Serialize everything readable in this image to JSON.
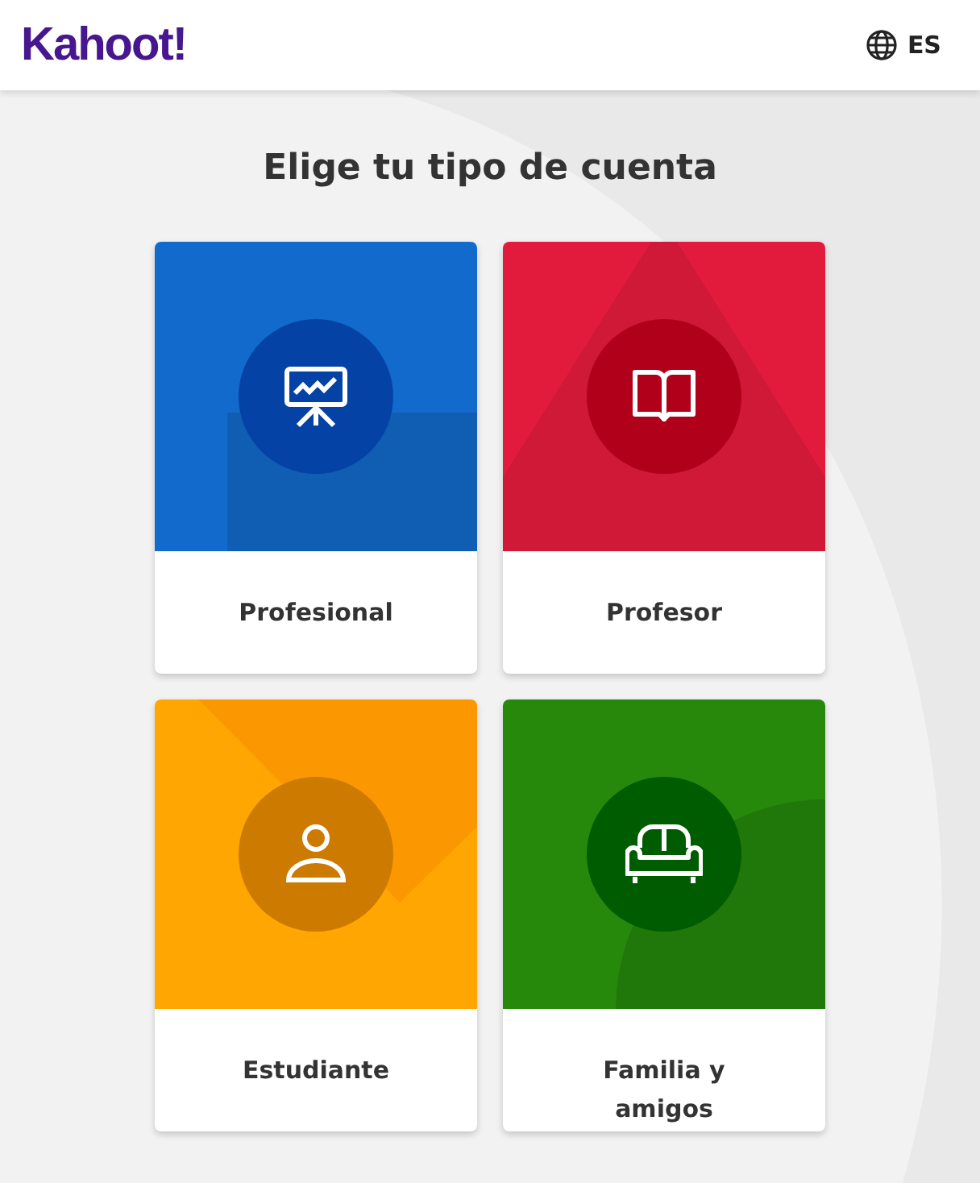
{
  "header": {
    "logo": "Kahoot!",
    "language": "ES"
  },
  "title": "Elige tu tipo de cuenta",
  "account_types": [
    {
      "kind": "presentation",
      "label": "Profesional",
      "color": "#136acd"
    },
    {
      "kind": "book",
      "label": "Profesor",
      "color": "#e21b3c"
    },
    {
      "kind": "person",
      "label": "Estudiante",
      "color": "#ffa602"
    },
    {
      "kind": "sofa",
      "label": "Familia y amigos",
      "color": "#26890c"
    }
  ]
}
